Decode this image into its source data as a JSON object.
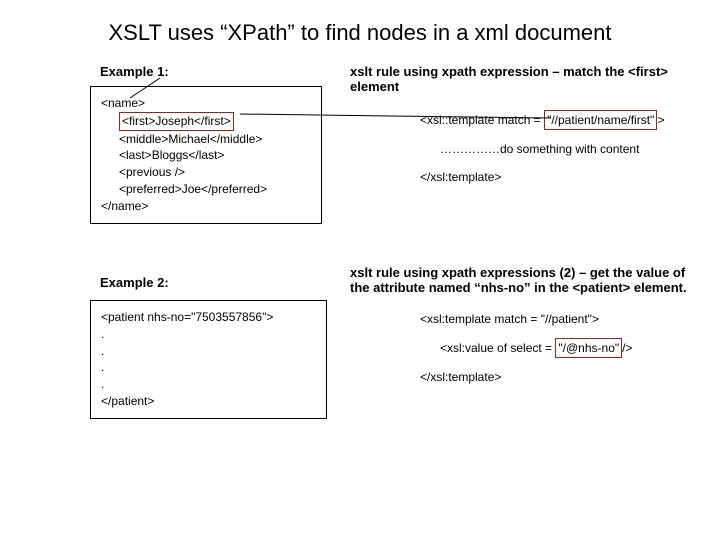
{
  "title": "XSLT uses “XPath” to find nodes in a xml document",
  "ex1": {
    "label": "Example 1:",
    "open": "<name>",
    "first": "<first>Joseph</first>",
    "middle": "<middle>Michael</middle>",
    "last": "<last>Bloggs</last>",
    "previous": "<previous />",
    "preferred": "<preferred>Joe</preferred>",
    "close": "</name>"
  },
  "rule1": {
    "label": "xslt rule using xpath expression – match the <first> element",
    "open_prefix": "<xsl::template match =",
    "match": "\"//patient/name/first\"",
    "open_suffix": ">",
    "body": "……………do something with content",
    "close": "</xsl:template>"
  },
  "ex2": {
    "label": "Example 2:",
    "open": "<patient nhs-no=\"7503557856\">",
    "dot": ".",
    "close": "</patient>"
  },
  "rule2": {
    "label": "xslt rule using xpath expressions (2) – get the value of the attribute named “nhs-no” in the <patient> element.",
    "open": "<xsl:template match = \"//patient\">",
    "body_prefix": "<xsl:value of select =",
    "select": "\"/@nhs-no\"",
    "body_suffix": "/>",
    "close": "</xsl:template>"
  }
}
